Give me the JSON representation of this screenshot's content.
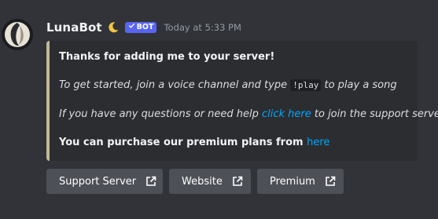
{
  "message": {
    "author": "LunaBot",
    "badge": "BOT",
    "timestamp": "Today at 5:33 PM",
    "embed_color": "#c2b896"
  },
  "embed": {
    "title": "Thanks for adding me to your server!",
    "start_prefix": "To get started, join a voice channel and type ",
    "start_command": "!play",
    "start_suffix": " to play a song",
    "help_prefix": "If you have any questions or need help ",
    "help_link": "click here",
    "help_suffix": " to join the support server",
    "premium_prefix": "You can purchase our premium plans from ",
    "premium_link": "here"
  },
  "buttons": {
    "support": "Support Server",
    "website": "Website",
    "premium": "Premium"
  },
  "icons": {
    "moon": "crescent-moon-icon",
    "badge_check": "check-icon",
    "external": "external-link-icon"
  }
}
